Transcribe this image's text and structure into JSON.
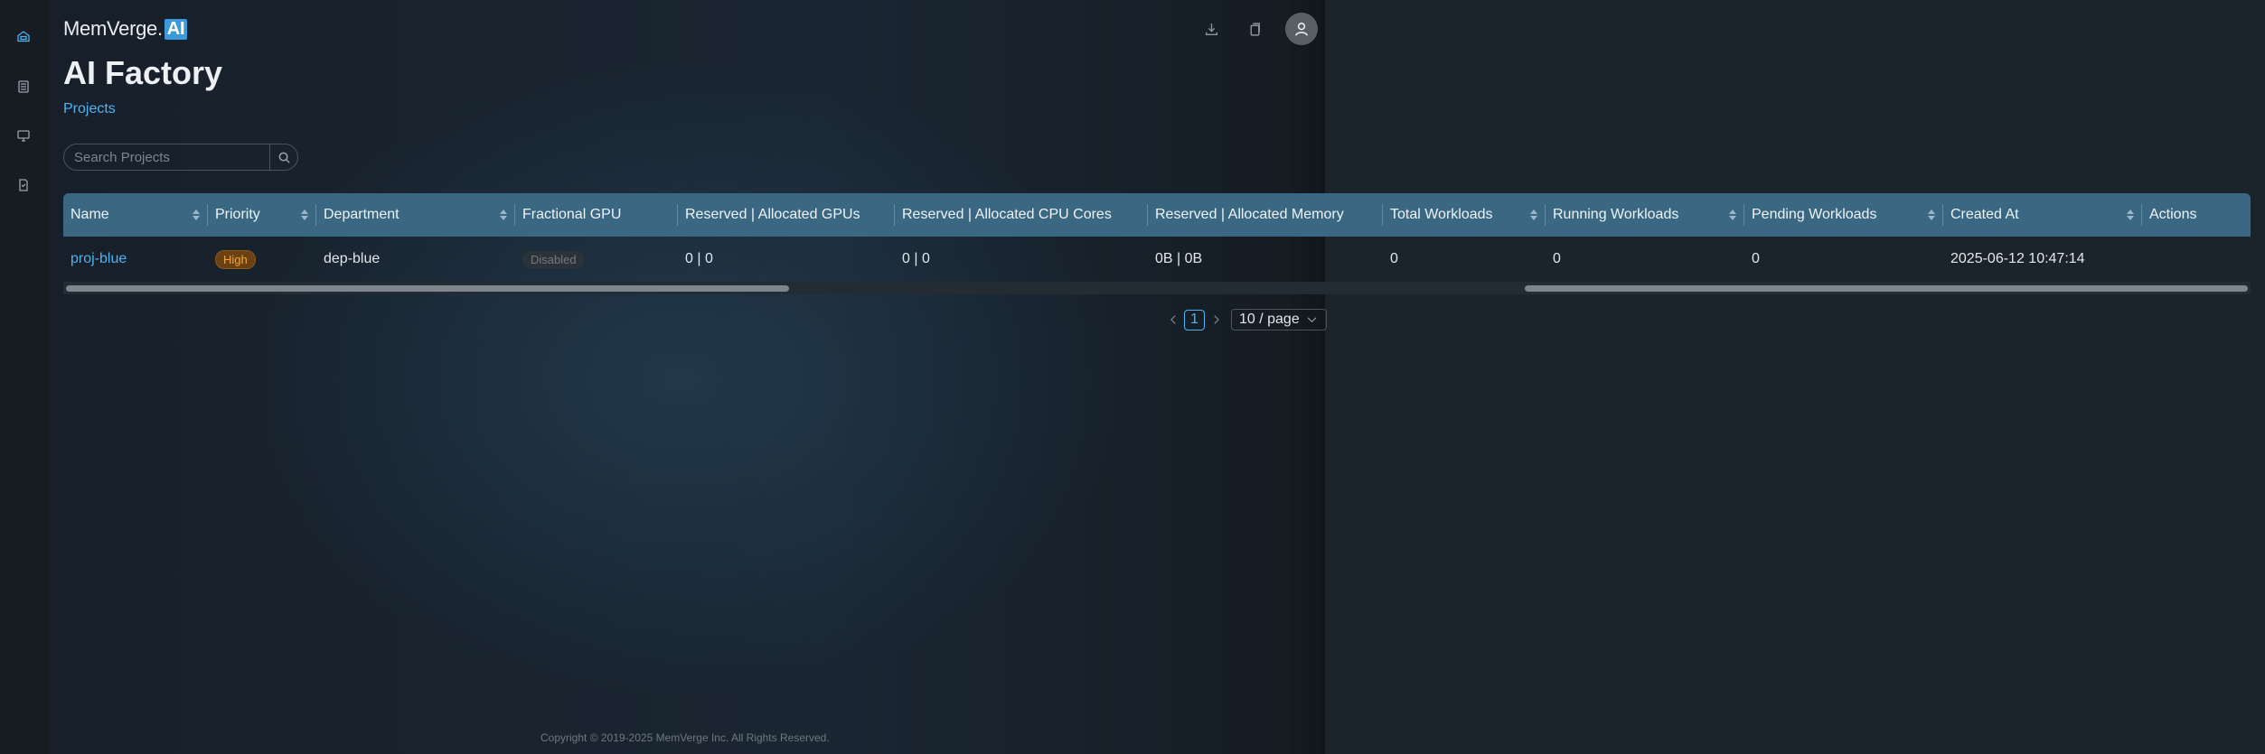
{
  "brand": {
    "name": "MemVerge.",
    "ai_badge": "AI"
  },
  "page": {
    "title": "AI Factory",
    "breadcrumb": "Projects"
  },
  "sidebar": {
    "items": [
      {
        "icon": "home-icon"
      },
      {
        "icon": "list-icon"
      },
      {
        "icon": "monitor-icon"
      },
      {
        "icon": "document-icon"
      }
    ]
  },
  "header_actions": [
    {
      "icon": "download-icon"
    },
    {
      "icon": "clipboard-icon"
    },
    {
      "icon": "user-avatar-icon"
    }
  ],
  "search": {
    "placeholder": "Search Projects",
    "value": ""
  },
  "table": {
    "columns": [
      "Name",
      "Priority",
      "Department",
      "Fractional GPU",
      "Reserved | Allocated GPUs",
      "Reserved | Allocated CPU Cores",
      "Reserved | Allocated Memory",
      "Total Workloads",
      "Running Workloads",
      "Pending Workloads",
      "Created At",
      "Actions"
    ],
    "rows": [
      {
        "name": "proj-blue",
        "priority": "High",
        "department": "dep-blue",
        "fractional_gpu": "Disabled",
        "gpus": "0 | 0",
        "cpu_cores": "0 | 0",
        "memory": "0B | 0B",
        "total_workloads": "0",
        "running_workloads": "0",
        "pending_workloads": "0",
        "created_at": "2025-06-12 10:47:14",
        "actions": ""
      }
    ]
  },
  "pagination": {
    "current_page": "1",
    "page_size": "10 / page"
  },
  "footer": {
    "copyright": "Copyright © 2019-2025 MemVerge Inc. All Rights Reserved."
  },
  "colors": {
    "accent": "#4fb3f0",
    "header_bg": "#3a6782",
    "priority_high": "#f0a43c"
  }
}
